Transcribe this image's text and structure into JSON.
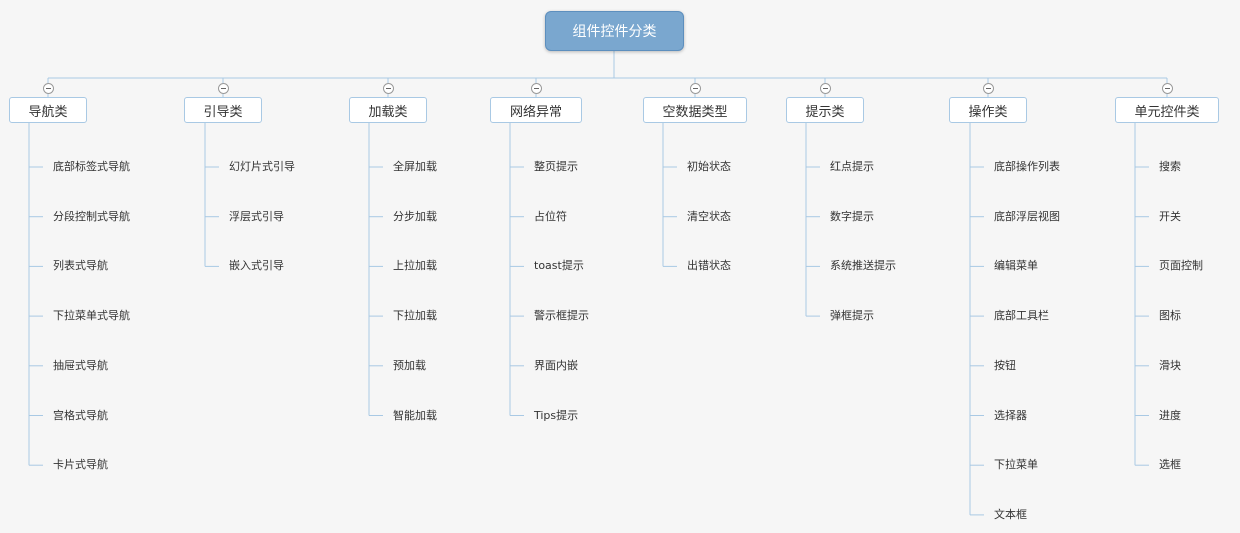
{
  "root": {
    "label": "组件控件分类"
  },
  "categories": [
    {
      "label": "导航类",
      "children": [
        "底部标签式导航",
        "分段控制式导航",
        "列表式导航",
        "下拉菜单式导航",
        "抽屉式导航",
        "宫格式导航",
        "卡片式导航"
      ]
    },
    {
      "label": "引导类",
      "children": [
        "幻灯片式引导",
        "浮层式引导",
        "嵌入式引导"
      ]
    },
    {
      "label": "加载类",
      "children": [
        "全屏加载",
        "分步加载",
        "上拉加载",
        "下拉加载",
        "预加载",
        "智能加载"
      ]
    },
    {
      "label": "网络异常",
      "children": [
        "整页提示",
        "占位符",
        "toast提示",
        "警示框提示",
        "界面内嵌",
        "Tips提示"
      ]
    },
    {
      "label": "空数据类型",
      "children": [
        "初始状态",
        "清空状态",
        "出错状态"
      ]
    },
    {
      "label": "提示类",
      "children": [
        "红点提示",
        "数字提示",
        "系统推送提示",
        "弹框提示"
      ]
    },
    {
      "label": "操作类",
      "children": [
        "底部操作列表",
        "底部浮层视图",
        "编辑菜单",
        "底部工具栏",
        "按钮",
        "选择器",
        "下拉菜单",
        "文本框"
      ]
    },
    {
      "label": "单元控件类",
      "children": [
        "搜索",
        "开关",
        "页面控制",
        "图标",
        "滑块",
        "进度",
        "选框"
      ]
    }
  ],
  "colors": {
    "root_fill": "#7aa7cf",
    "node_border": "#a9c9e4",
    "connector": "#a9c9e4",
    "background": "#f6f6f6"
  },
  "icons": {
    "collapse": "minus-circle-icon"
  }
}
